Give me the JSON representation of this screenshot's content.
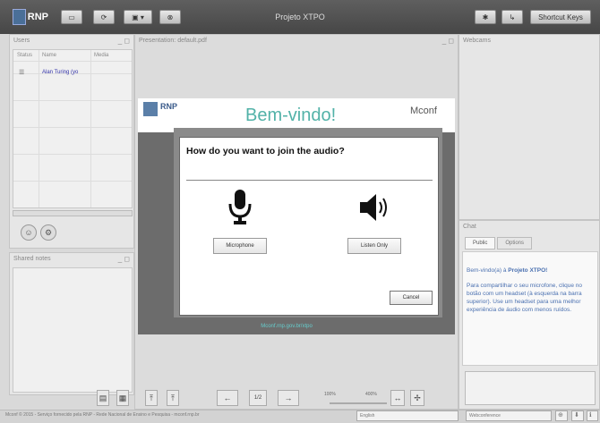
{
  "topbar": {
    "logo_text": "RNP",
    "title": "Projeto XTPO",
    "shortcut_keys": "Shortcut Keys",
    "icons": [
      "monitor-icon",
      "refresh-icon",
      "screen-share-icon",
      "chevron-down-icon",
      "disconnect-icon",
      "gear-icon",
      "logout-icon"
    ]
  },
  "users": {
    "title": "Users",
    "columns": [
      "Status",
      "Name",
      "Media"
    ],
    "rows": [
      {
        "name": "Alan Turing (yo"
      }
    ]
  },
  "shared_notes": {
    "title": "Shared notes"
  },
  "presentation": {
    "title": "Presentation: default.pdf",
    "slide_logo": "RNP",
    "slide_heading": "Bem-vindo!",
    "slide_brand": "Mconf",
    "slide_footer": "Mconf.rnp.gov.br/xtpo",
    "page": "1/2",
    "zoom_min": "100%",
    "zoom_max": "400%"
  },
  "modal": {
    "question": "How do you want to join the audio?",
    "mic_option": "Microphone",
    "listen_option": "Listen Only",
    "cancel": "Cancel"
  },
  "webcams": {
    "title": "Webcams"
  },
  "chat": {
    "title": "Chat",
    "tabs": [
      "Public",
      "Options"
    ],
    "welcome_prefix": "Bem-vindo(a) à ",
    "welcome_room": "Projeto XTPO!",
    "message": "Para compartilhar o seu microfone, clique no botão com um headset (à esquerda na barra superior). Use um headset para uma melhor experiência de áudio com menos ruídos."
  },
  "footer": {
    "text": "Mconf © 2015 - Serviço fornecido pela RNP - Rede Nacional de Ensino e Pesquisa - mconf.rnp.br",
    "language": "English",
    "layout": "Webconference"
  }
}
